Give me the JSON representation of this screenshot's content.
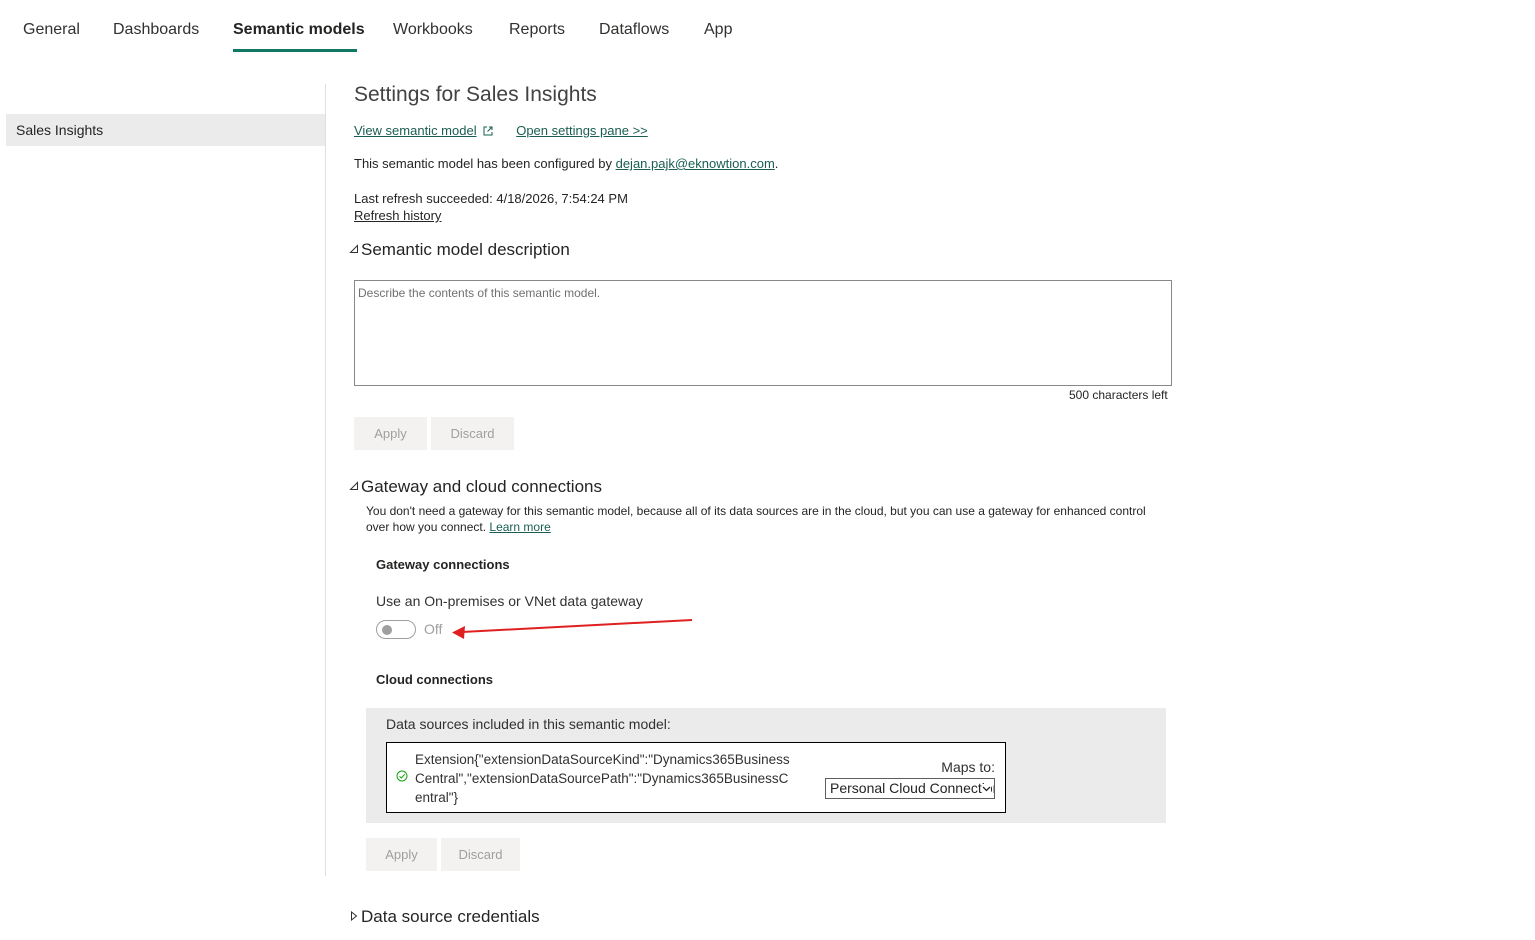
{
  "tabs": [
    {
      "label": "General",
      "active": false
    },
    {
      "label": "Dashboards",
      "active": false
    },
    {
      "label": "Semantic models",
      "active": true
    },
    {
      "label": "Workbooks",
      "active": false
    },
    {
      "label": "Reports",
      "active": false
    },
    {
      "label": "Dataflows",
      "active": false
    },
    {
      "label": "App",
      "active": false
    }
  ],
  "sidebar": {
    "items": [
      {
        "label": "Sales Insights",
        "selected": true
      }
    ]
  },
  "settings": {
    "title": "Settings for Sales Insights",
    "view_model_link": "View semantic model",
    "open_pane_link": "Open settings pane >>",
    "configured_prefix": "This semantic model has been configured by ",
    "configured_email": "dejan.pajk@eknowtion.com",
    "configured_suffix": ".",
    "last_refresh": "Last refresh succeeded: 4/18/2026, 7:54:24 PM",
    "refresh_history_link": "Refresh history"
  },
  "description_section": {
    "header": "Semantic model description",
    "placeholder": "Describe the contents of this semantic model.",
    "chars_left": "500 characters left",
    "apply_label": "Apply",
    "discard_label": "Discard"
  },
  "gateway_section": {
    "header": "Gateway and cloud connections",
    "description": "You don't need a gateway for this semantic model, because all of its data sources are in the cloud, but you can use a gateway for enhanced control over how you connect. ",
    "learn_more": "Learn more",
    "gateway_connections_label": "Gateway connections",
    "use_gateway_label": "Use an On-premises or VNet data gateway",
    "toggle_state": "Off",
    "cloud_connections_label": "Cloud connections",
    "data_sources_label": "Data sources included in this semantic model:",
    "data_source": "Extension{\"extensionDataSourceKind\":\"Dynamics365BusinessCentral\",\"extensionDataSourcePath\":\"Dynamics365BusinessCentral\"}",
    "maps_to_label": "Maps to:",
    "maps_to_value": "Personal Cloud Connection",
    "apply_label": "Apply",
    "discard_label": "Discard"
  },
  "credentials_section": {
    "header": "Data source credentials"
  },
  "colors": {
    "accent": "#117865",
    "link": "#1a5e52",
    "annotation_arrow": "#e02020"
  }
}
